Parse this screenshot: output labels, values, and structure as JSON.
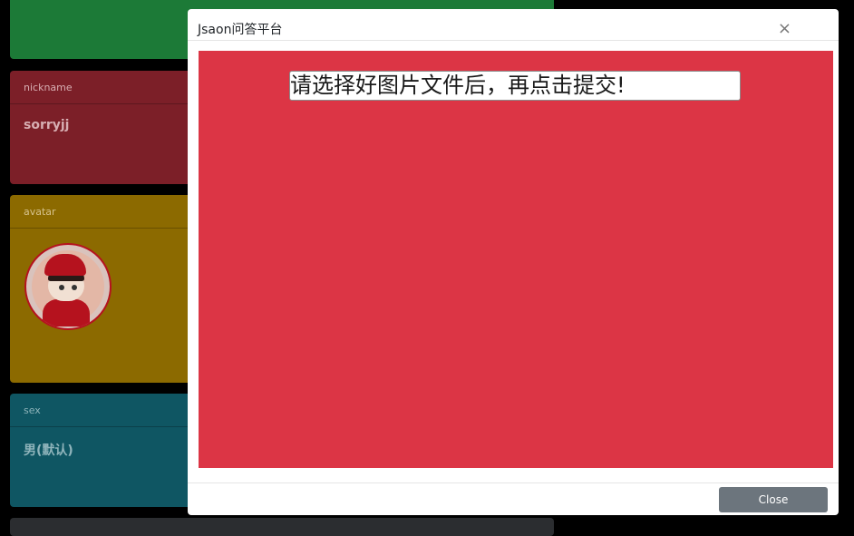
{
  "background": {
    "nickname_card": {
      "label": "nickname",
      "value": "sorryjj"
    },
    "avatar_card": {
      "label": "avatar"
    },
    "sex_card": {
      "label": "sex",
      "value": "男(默认)"
    }
  },
  "modal": {
    "title": "Jsaon问答平台",
    "close_symbol": "×",
    "file_field_text": "请选择好图片文件后，再点击提交!",
    "close_button_label": "Close"
  },
  "colors": {
    "modal_body": "#dc3545",
    "close_button": "#6c757d",
    "card_green": "#1c7a37",
    "card_red": "#7c1f28",
    "card_yellow": "#8c6a00",
    "card_teal": "#0f5663"
  },
  "icons": {
    "close": "close-icon",
    "avatar": "avatar-image"
  }
}
